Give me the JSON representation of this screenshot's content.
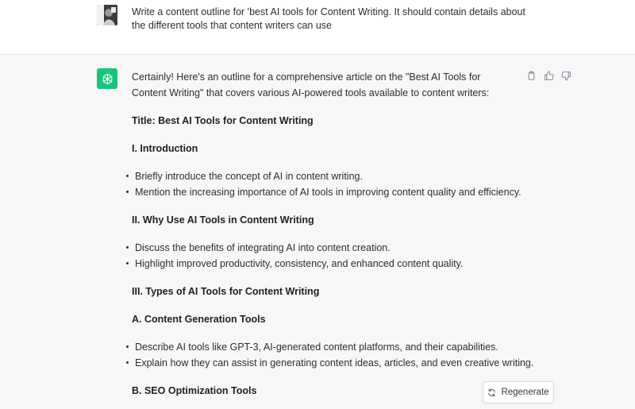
{
  "user_message": {
    "text": "Write a content outline for 'best AI tools for Content Writing. It should contain details about the different tools that content writers can use"
  },
  "assistant_message": {
    "intro": "Certainly! Here's an outline for a comprehensive article on the \"Best AI Tools for Content Writing\" that covers various AI-powered tools available to content writers:",
    "title": "Title: Best AI Tools for Content Writing",
    "sections": [
      {
        "heading": "I. Introduction",
        "bullets": [
          "Briefly introduce the concept of AI in content writing.",
          "Mention the increasing importance of AI tools in improving content quality and efficiency."
        ]
      },
      {
        "heading": "II. Why Use AI Tools in Content Writing",
        "bullets": [
          "Discuss the benefits of integrating AI into content creation.",
          "Highlight improved productivity, consistency, and enhanced content quality."
        ]
      },
      {
        "heading": "III. Types of AI Tools for Content Writing",
        "bullets": []
      },
      {
        "heading": "A. Content Generation Tools",
        "bullets": [
          "Describe AI tools like GPT-3, AI-generated content platforms, and their capabilities.",
          "Explain how they can assist in generating content ideas, articles, and even creative writing."
        ]
      },
      {
        "heading": "B. SEO Optimization Tools",
        "bullets": []
      }
    ]
  },
  "actions": {
    "copy_icon": "clipboard-icon",
    "like_icon": "thumbs-up-icon",
    "dislike_icon": "thumbs-down-icon"
  },
  "regenerate": {
    "label": "Regenerate",
    "icon": "refresh-icon"
  },
  "colors": {
    "assistant_bg": "#f7f7f8",
    "bot_avatar": "#19c37d",
    "text": "#2d2d35"
  }
}
